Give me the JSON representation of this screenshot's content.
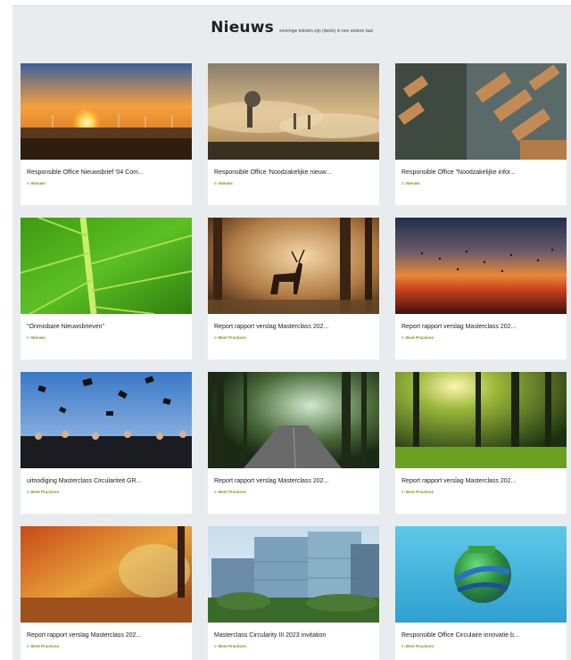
{
  "header": {
    "title": "Nieuws",
    "subtitle": "sommige teksten zijn (deels) in een andere taal"
  },
  "category_prefix": "In",
  "cards": [
    {
      "title": "Responsible Office Nieuwsbrief '04 Com...",
      "category": "Nieuws",
      "image": "sunset-windmills"
    },
    {
      "title": "Responsible Office 'Noodzakelijke nieuw...",
      "category": "Nieuws",
      "image": "misty-industry"
    },
    {
      "title": "Responsible Office \"Noodzakelijke infor...",
      "category": "Nieuws",
      "image": "logs-aerial"
    },
    {
      "title": "\"Onmisbare  Nieuwsbrieven\"",
      "category": "Nieuws",
      "image": "green-leaf"
    },
    {
      "title": "Report rapport verslag Masterclass 202...",
      "category": "Best Practices",
      "image": "deer-forest"
    },
    {
      "title": "Report rapport verslag Masterclass 202...",
      "category": "Best Practices",
      "image": "birds-sunset"
    },
    {
      "title": "uitnodiging  Masterclass Circulariteit GR...",
      "category": "Best Practices",
      "image": "graduation"
    },
    {
      "title": "Report rapport verslag Masterclass 202...",
      "category": "Best Practices",
      "image": "forest-road"
    },
    {
      "title": "Report rapport verslag Masterclass 202...",
      "category": "Best Practices",
      "image": "sunlit-forest"
    },
    {
      "title": "Report rapport verslag Masterclass 202...",
      "category": "Best Practices",
      "image": "autumn-forest"
    },
    {
      "title": "Masterclass Circularity III 2023 invitation",
      "category": "Best Practices",
      "image": "green-building"
    },
    {
      "title": "Responsible Office Circulaire innovatie b...",
      "category": "Best Practices",
      "image": "earth-globe"
    }
  ]
}
